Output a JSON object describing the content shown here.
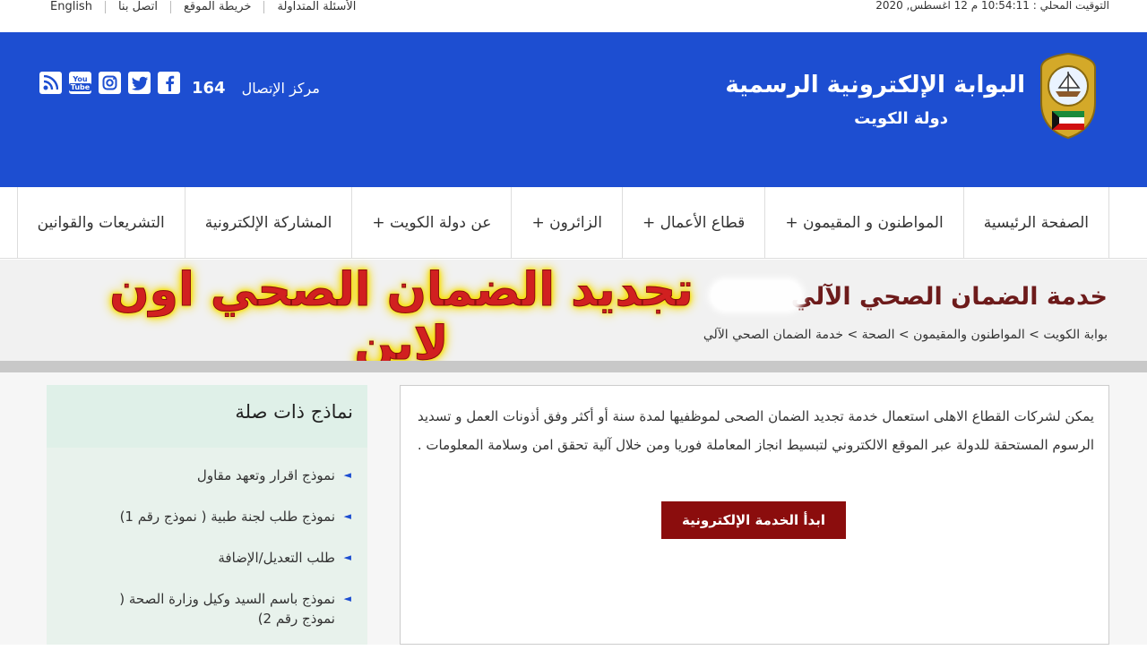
{
  "topbar": {
    "links": [
      "English",
      "اتصل بنا",
      "خريطة الموقع",
      "الأسئلة المتداولة"
    ],
    "clock_label": "التوقيت المحلي :",
    "clock_value": "10:54:11 م 12 اغسطس, 2020"
  },
  "header": {
    "title": "البوابة الإلكترونية الرسمية",
    "subtitle": "دولة الكويت",
    "contact_label": "مركز الإتصال",
    "contact_number": "164",
    "social": [
      {
        "icon": "rss-icon",
        "glyph": "◉"
      },
      {
        "icon": "youtube-icon",
        "glyph": "You"
      },
      {
        "icon": "instagram-icon",
        "glyph": "◎"
      },
      {
        "icon": "twitter-icon",
        "glyph": "t"
      },
      {
        "icon": "facebook-icon",
        "glyph": "f"
      }
    ]
  },
  "nav": {
    "items": [
      "الصفحة الرئيسية",
      "المواطنون و المقيمون +",
      "قطاع الأعمال +",
      "الزائرون +",
      "عن دولة الكويت +",
      "المشاركة الإلكترونية",
      "التشريعات والقوانين"
    ]
  },
  "page": {
    "title": "خدمة الضمان الصحي الآلي",
    "overlay": "تجديد الضمان الصحي اون لاين",
    "breadcrumb": "بوابة الكويت > المواطنون والمقيمون > الصحة > خدمة الضمان الصحي الآلي"
  },
  "main": {
    "description": "يمكن لشركات القطاع الاهلى استعمال خدمة تجديد الضمان الصحى لموظفيها لمدة سنة أو أكثر وفق أذونات العمل و تسديد الرسوم المستحقة للدولة عبر الموقع الالكتروني لتبسيط انجاز المعاملة فوريا ومن خلال آلية تحقق امن وسلامة المعلومات .",
    "start_button": "ابدأ الخدمة الإلكترونية"
  },
  "sidebar": {
    "title": "نماذج ذات صلة",
    "items": [
      "نموذج اقرار وتعهد مقاول",
      "نموذج طلب لجنة طبية ( نموذج رقم 1)",
      "طلب التعديل/الإضافة",
      "نموذج باسم السيد وكيل وزارة الصحة ( نموذج رقم 2)"
    ]
  },
  "colors": {
    "header_blue": "#1d4ed1",
    "title_maroon": "#6d1b1b",
    "button_maroon": "#8b0d0d",
    "overlay_red": "#d12020",
    "overlay_glow": "#f8e000"
  }
}
